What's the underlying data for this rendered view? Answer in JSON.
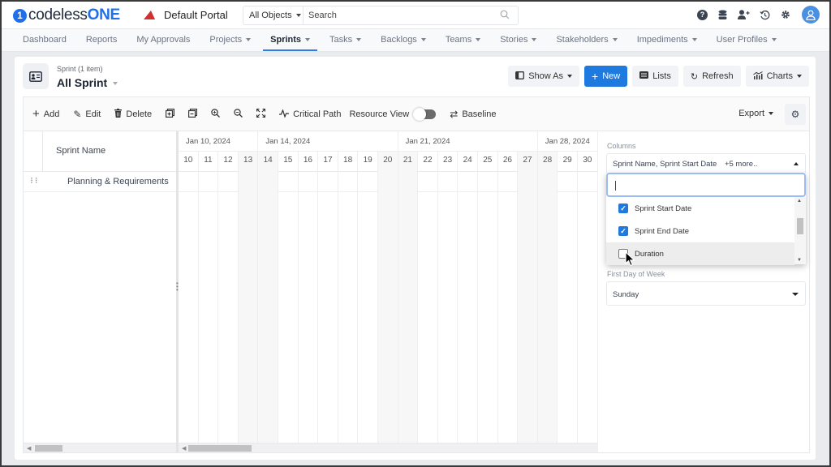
{
  "app": {
    "logo_prefix": "codeless",
    "logo_suffix": "ONE",
    "portal_name": "Default Portal"
  },
  "search": {
    "scope": "All Objects",
    "placeholder": "Search"
  },
  "top_icons": [
    "help-icon",
    "database-icon",
    "add-user-icon",
    "history-icon",
    "settings-icon",
    "user-avatar"
  ],
  "nav": {
    "items": [
      {
        "label": "Dashboard",
        "dropdown": false,
        "active": false
      },
      {
        "label": "Reports",
        "dropdown": false,
        "active": false
      },
      {
        "label": "My Approvals",
        "dropdown": false,
        "active": false
      },
      {
        "label": "Projects",
        "dropdown": true,
        "active": false
      },
      {
        "label": "Sprints",
        "dropdown": true,
        "active": true
      },
      {
        "label": "Tasks",
        "dropdown": true,
        "active": false
      },
      {
        "label": "Backlogs",
        "dropdown": true,
        "active": false
      },
      {
        "label": "Teams",
        "dropdown": true,
        "active": false
      },
      {
        "label": "Stories",
        "dropdown": true,
        "active": false
      },
      {
        "label": "Stakeholders",
        "dropdown": true,
        "active": false
      },
      {
        "label": "Impediments",
        "dropdown": true,
        "active": false
      },
      {
        "label": "User Profiles",
        "dropdown": true,
        "active": false
      }
    ]
  },
  "header": {
    "subtitle": "Sprint (1 item)",
    "title": "All Sprint",
    "actions": {
      "show_as": "Show As",
      "new": "New",
      "lists": "Lists",
      "refresh": "Refresh",
      "charts": "Charts"
    }
  },
  "toolbar": {
    "add": "Add",
    "edit": "Edit",
    "delete": "Delete",
    "critical_path": "Critical Path",
    "resource_view": "Resource View",
    "resource_view_on": false,
    "baseline": "Baseline",
    "export": "Export"
  },
  "grid": {
    "column_header": "Sprint Name",
    "rows": [
      {
        "name": "Planning & Requirements"
      }
    ]
  },
  "timeline": {
    "weeks": [
      {
        "label": "Jan 10, 2024",
        "days": 4
      },
      {
        "label": "Jan 14, 2024",
        "days": 7
      },
      {
        "label": "Jan 21, 2024",
        "days": 7
      },
      {
        "label": "Jan 28, 2024",
        "days": 3
      }
    ],
    "days": [
      {
        "d": "10",
        "weekend": false
      },
      {
        "d": "11",
        "weekend": false
      },
      {
        "d": "12",
        "weekend": false
      },
      {
        "d": "13",
        "weekend": true
      },
      {
        "d": "14",
        "weekend": true
      },
      {
        "d": "15",
        "weekend": false
      },
      {
        "d": "16",
        "weekend": false
      },
      {
        "d": "17",
        "weekend": false
      },
      {
        "d": "18",
        "weekend": false
      },
      {
        "d": "19",
        "weekend": false
      },
      {
        "d": "20",
        "weekend": true
      },
      {
        "d": "21",
        "weekend": true
      },
      {
        "d": "22",
        "weekend": false
      },
      {
        "d": "23",
        "weekend": false
      },
      {
        "d": "24",
        "weekend": false
      },
      {
        "d": "25",
        "weekend": false
      },
      {
        "d": "26",
        "weekend": false
      },
      {
        "d": "27",
        "weekend": true
      },
      {
        "d": "28",
        "weekend": true
      },
      {
        "d": "29",
        "weekend": false
      },
      {
        "d": "30",
        "weekend": false
      }
    ]
  },
  "settings_panel": {
    "columns_label": "Columns",
    "columns_value": "Sprint Name, Sprint Start Date",
    "columns_more": "+5 more..",
    "column_search_value": "",
    "column_options": [
      {
        "label": "Sprint Start Date",
        "checked": true
      },
      {
        "label": "Sprint End Date",
        "checked": true
      },
      {
        "label": "Duration",
        "checked": false,
        "hovered": true
      }
    ],
    "first_day_label": "First Day of Week",
    "first_day_value": "Sunday"
  },
  "colors": {
    "accent": "#1f7ae0",
    "brand_red": "#d32f2f",
    "weekend_shade": "#f7f7f7"
  }
}
